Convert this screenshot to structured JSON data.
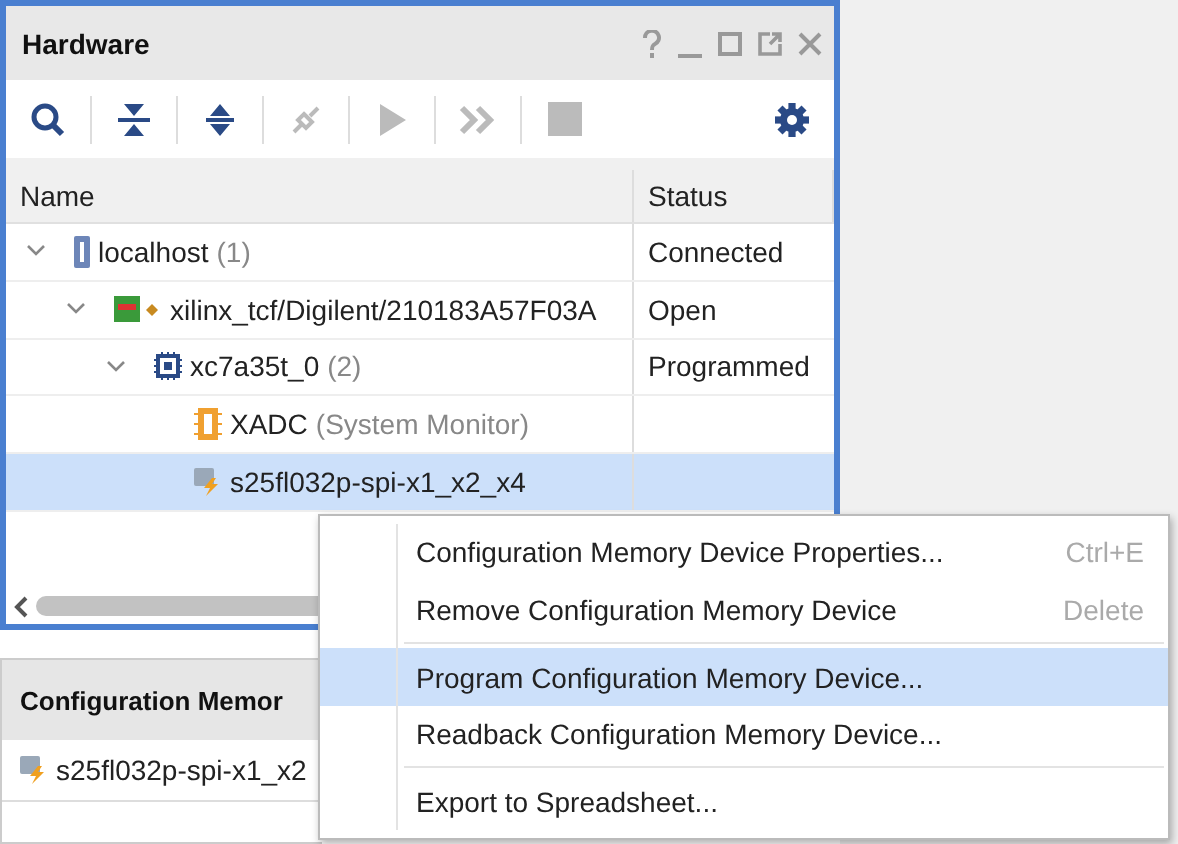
{
  "hardware_panel": {
    "title": "Hardware",
    "toolbar": [
      {
        "kind": "search",
        "disabled": false
      },
      {
        "kind": "collapse",
        "disabled": false
      },
      {
        "kind": "expand",
        "disabled": false
      },
      {
        "kind": "connect",
        "disabled": true
      },
      {
        "kind": "run",
        "disabled": true
      },
      {
        "kind": "forward",
        "disabled": true
      },
      {
        "kind": "stop",
        "disabled": true
      },
      {
        "kind": "settings",
        "disabled": false
      }
    ],
    "columns": [
      "Name",
      "Status"
    ],
    "tree": [
      {
        "kind": "host",
        "name": "localhost",
        "count": "(1)",
        "status": "Connected",
        "expanded": true,
        "selected": false,
        "children": [
          {
            "kind": "cable",
            "name": "xilinx_tcf/Digilent/210183A57F03A",
            "status": "Open",
            "expanded": true,
            "selected": false,
            "children": [
              {
                "kind": "fpga",
                "name": "xc7a35t_0",
                "count": "(2)",
                "status": "Programmed",
                "expanded": true,
                "selected": false,
                "children": [
                  {
                    "kind": "xadc",
                    "name": "XADC",
                    "note": "(System Monitor)",
                    "selected": false
                  },
                  {
                    "kind": "flash",
                    "name": "s25fl032p-spi-x1_x2_x4",
                    "selected": true
                  }
                ]
              }
            ]
          }
        ]
      }
    ]
  },
  "config_memory_panel": {
    "title": "Configuration Memor",
    "rows": [
      {
        "name": "s25fl032p-spi-x1_x2"
      }
    ]
  },
  "context_menu": [
    {
      "label": "Configuration Memory Device Properties...",
      "shortcut": "Ctrl+E",
      "selected": false,
      "separator_before": false
    },
    {
      "label": "Remove Configuration Memory Device",
      "shortcut": "Delete",
      "selected": false,
      "separator_before": false
    },
    {
      "label": "Program Configuration Memory Device...",
      "selected": true,
      "separator_before": true
    },
    {
      "label": "Readback Configuration Memory Device...",
      "selected": false,
      "separator_before": false
    },
    {
      "label": "Export to Spreadsheet...",
      "selected": false,
      "separator_before": true
    }
  ]
}
